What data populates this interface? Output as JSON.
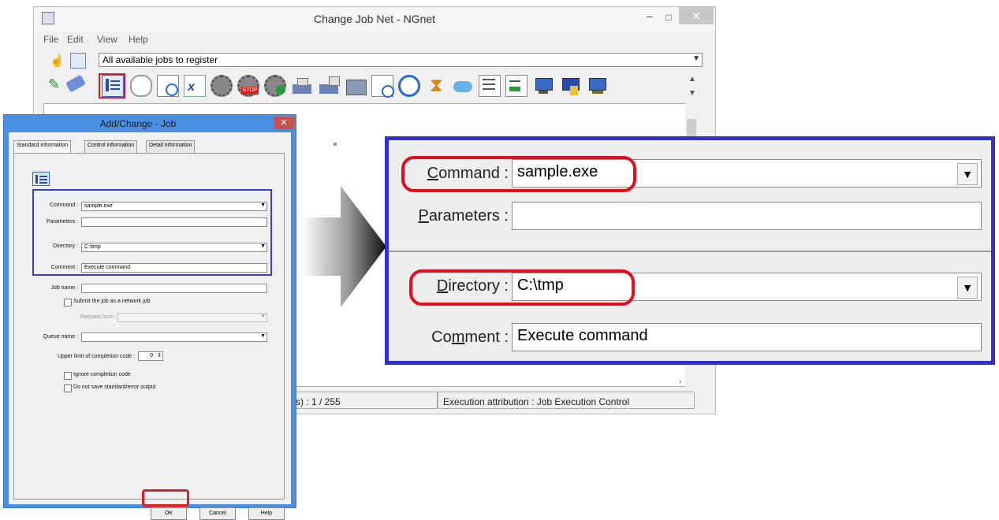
{
  "main_window": {
    "title": "Change Job Net - NGnet",
    "window_controls": {
      "minimize": "–",
      "maximize": "□",
      "close": "✕"
    },
    "menu": [
      "File",
      "Edit",
      "View",
      "Help"
    ],
    "job_category": "All available jobs to register",
    "toolbar_icons": [
      "job-icon",
      "message-icon",
      "document-search-icon",
      "spreadsheet-icon",
      "gear-icon",
      "stop-gear-icon",
      "gear-check-icon",
      "network-printer-icon",
      "network-transfer-icon",
      "folder-tray-icon",
      "file-check-icon",
      "alarm-clock-icon",
      "hourglass-icon",
      "cloud-icon",
      "list-icon",
      "list-arrow-icon",
      "computer-icon",
      "server-icon",
      "computer-connect-icon"
    ],
    "status": {
      "count_text": "(s) : 1 / 255",
      "attribution": "Execution attribution : Job Execution Control"
    }
  },
  "dialog": {
    "title": "Add/Change - Job",
    "close": "✕",
    "tabs": [
      "Standard information",
      "Control information",
      "Detail information"
    ],
    "fields": {
      "command_label": "Command :",
      "command_value": "sample.exe",
      "parameters_label": "Parameters :",
      "parameters_value": "",
      "directory_label": "Directory :",
      "directory_value": "C:\\tmp",
      "comment_label": "Comment :",
      "comment_value": "Execute command",
      "job_name_label": "Job name :",
      "job_name_value": "",
      "submit_network_label": "Submit the job as a network job",
      "request_host_label": "Request host :",
      "queue_name_label": "Queue name :",
      "upper_limit_label": "Upper limit of completion code :",
      "upper_limit_value": "0",
      "ignore_code_label": "Ignore completion code",
      "no_save_output_label": "Do not save standard/error output"
    },
    "buttons": {
      "ok": "OK",
      "cancel": "Cancel",
      "help": "Help"
    }
  },
  "zoom": {
    "command_label": "Command :",
    "command_value": "sample.exe",
    "parameters_label": "Parameters :",
    "parameters_value": "",
    "directory_label": "Directory :",
    "directory_value": "C:\\tmp",
    "comment_label": "Comment :",
    "comment_value": "Execute command"
  },
  "colors": {
    "highlight_red": "#e0101e",
    "highlight_blue": "#2f31c9",
    "dialog_frame": "#4b8fe3"
  }
}
